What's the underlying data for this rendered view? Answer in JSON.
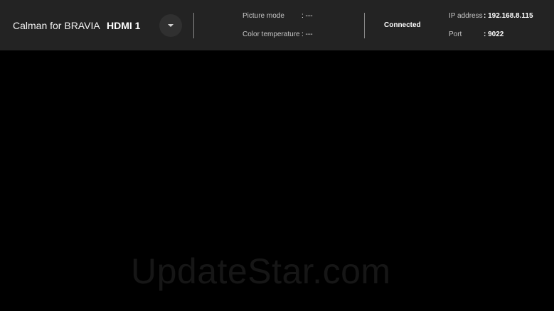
{
  "header": {
    "app_title": "Calman for BRAVIA",
    "input_source": "HDMI 1",
    "dropdown_icon": "chevron-down-icon"
  },
  "picture_info": {
    "picture_mode_label": "Picture mode",
    "picture_mode_value": ": ---",
    "color_temperature_label": "Color temperature",
    "color_temperature_value": ": ---"
  },
  "connection": {
    "status": "Connected",
    "ip_label": "IP address",
    "ip_value": ": 192.168.8.115",
    "port_label": "Port",
    "port_value": ": 9022"
  },
  "watermark": "UpdateStar.com",
  "colors": {
    "background": "#000000",
    "topbar": "#232323",
    "text": "#ffffff"
  }
}
